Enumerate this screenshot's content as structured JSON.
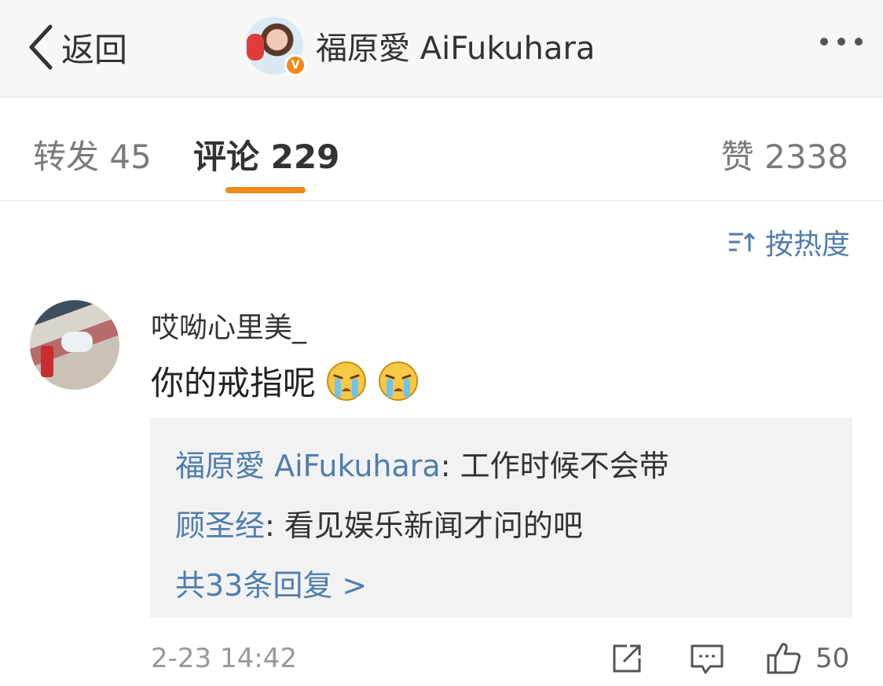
{
  "header": {
    "back_label": "返回",
    "title": "福原愛 AiFukuhara",
    "verified_badge": "V",
    "more_icon": "more-horizontal-icon"
  },
  "tabs": {
    "repost": "转发 45",
    "comment": "评论 229",
    "like": "赞 2338",
    "active": "comment"
  },
  "sort": {
    "label": "按热度",
    "icon": "sort-icon"
  },
  "comment": {
    "username": "哎呦心里美_",
    "text": "你的戒指呢",
    "emoji": [
      "crying-emoji",
      "crying-emoji"
    ],
    "replies": [
      {
        "name": "福原愛 AiFukuhara",
        "text": ": 工作时候不会带"
      },
      {
        "name": "顾圣经",
        "text": ": 看见娱乐新闻才问的吧"
      }
    ],
    "more_replies": "共33条回复 >",
    "time": "2-23 14:42",
    "like_count": "50"
  },
  "colors": {
    "accent": "#f08a1c",
    "link": "#507daf",
    "reply_bg": "#f2f2f2",
    "topbar_bg": "#f7f7f7"
  }
}
